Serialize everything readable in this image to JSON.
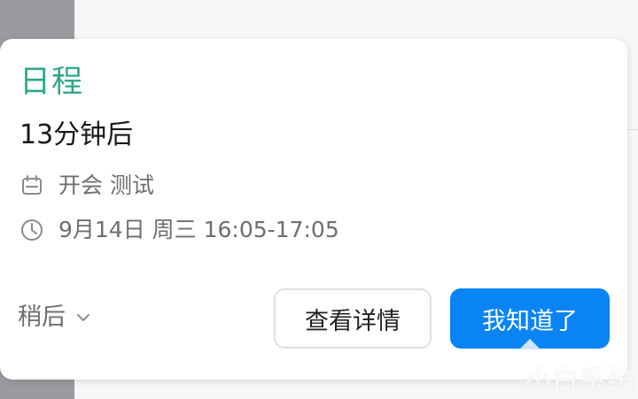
{
  "notification": {
    "app_name": "日程",
    "time_until": "13分钟后",
    "event_title": "开会 测试",
    "event_time": "9月14日 周三 16:05-17:05",
    "icons": {
      "event": "calendar-icon",
      "time": "clock-icon",
      "later": "chevron-down-icon"
    },
    "actions": {
      "later_label": "稍后",
      "detail_label": "查看详情",
      "ok_label": "我知道了"
    }
  },
  "watermark": "小白系统",
  "colors": {
    "app_name": "#2ea88b",
    "primary_button": "#0a84f5",
    "secondary_text": "#6e6e6e"
  }
}
